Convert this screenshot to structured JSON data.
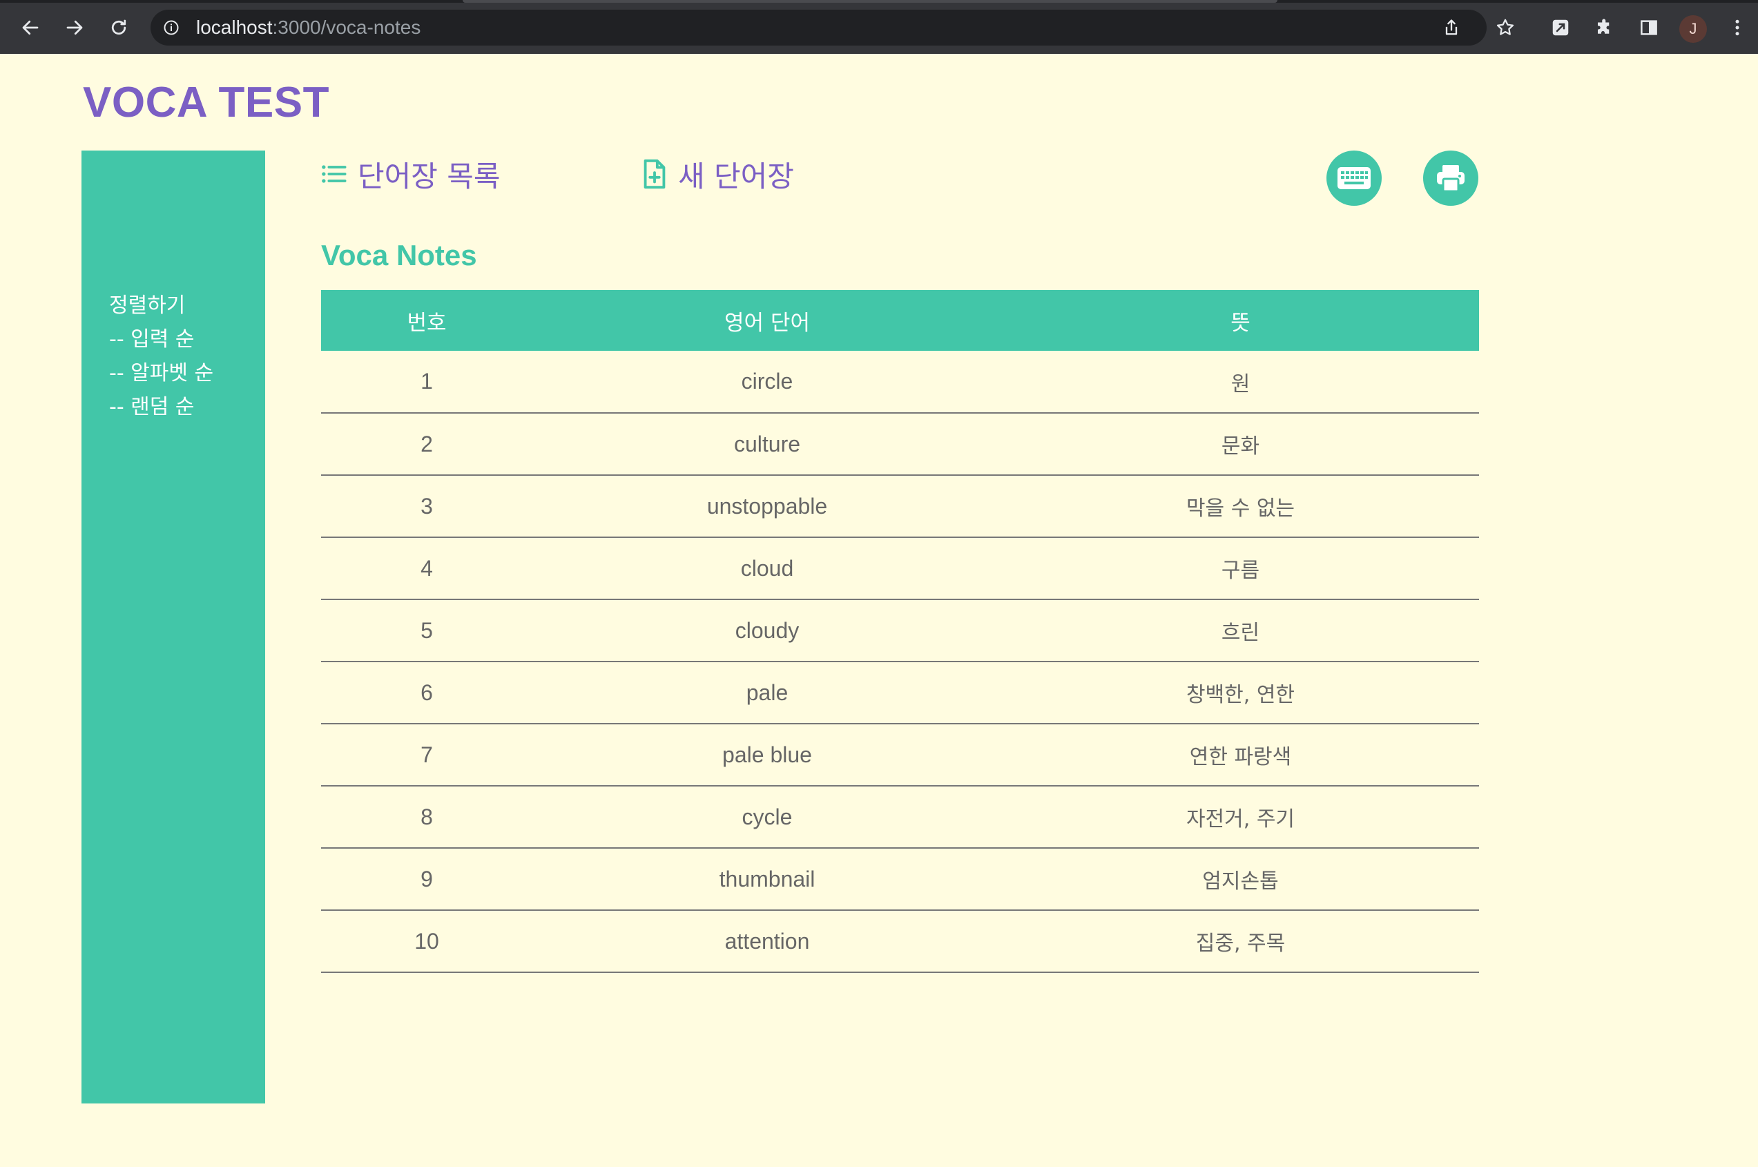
{
  "browser": {
    "url_host": "localhost",
    "url_path": ":3000/voca-notes",
    "avatar_letter": "J"
  },
  "app": {
    "title": "VOCA TEST"
  },
  "sidebar": {
    "heading": "정렬하기",
    "items": [
      {
        "label": "-- 입력 순"
      },
      {
        "label": "-- 알파벳 순"
      },
      {
        "label": "-- 랜덤 순"
      }
    ]
  },
  "nav": {
    "list_label": "단어장 목록",
    "new_label": "새 단어장"
  },
  "section": {
    "title": "Voca Notes"
  },
  "table": {
    "headers": [
      "번호",
      "영어 단어",
      "뜻"
    ],
    "rows": [
      {
        "no": "1",
        "word": "circle",
        "meaning": "원"
      },
      {
        "no": "2",
        "word": "culture",
        "meaning": "문화"
      },
      {
        "no": "3",
        "word": "unstoppable",
        "meaning": "막을 수 없는"
      },
      {
        "no": "4",
        "word": "cloud",
        "meaning": "구름"
      },
      {
        "no": "5",
        "word": "cloudy",
        "meaning": "흐린"
      },
      {
        "no": "6",
        "word": "pale",
        "meaning": "창백한, 연한"
      },
      {
        "no": "7",
        "word": "pale blue",
        "meaning": "연한 파랑색"
      },
      {
        "no": "8",
        "word": "cycle",
        "meaning": "자전거, 주기"
      },
      {
        "no": "9",
        "word": "thumbnail",
        "meaning": "엄지손톱"
      },
      {
        "no": "10",
        "word": "attention",
        "meaning": "집중, 주목"
      }
    ]
  },
  "icons": {
    "list": "list-icon",
    "new_note": "file-plus-icon",
    "keyboard": "keyboard-icon",
    "print": "print-icon"
  },
  "colors": {
    "background": "#fffce0",
    "accent_green": "#42c6a8",
    "accent_purple": "#7b5fc4",
    "text_gray": "#666666"
  }
}
